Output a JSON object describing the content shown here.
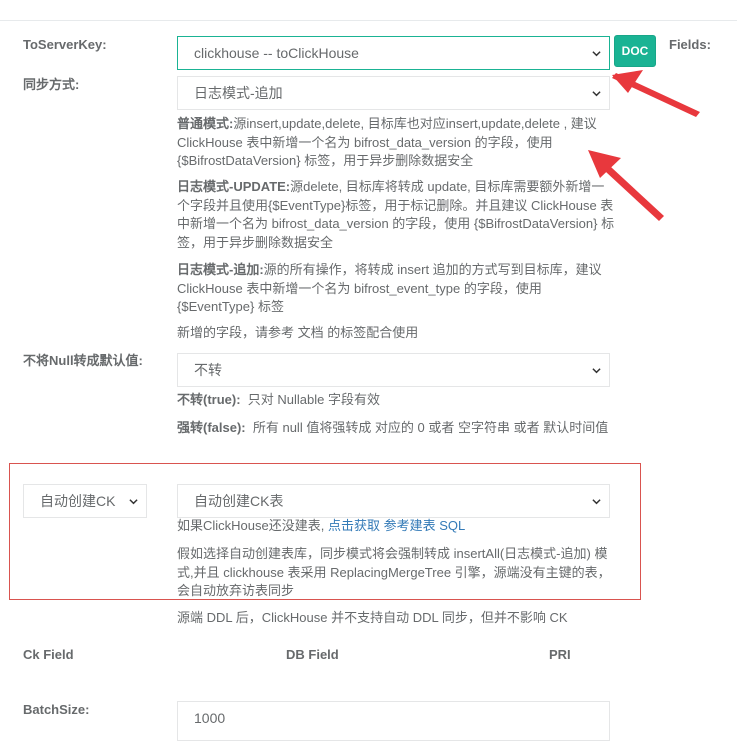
{
  "to_server_key": {
    "label": "ToServerKey:",
    "value": "clickhouse -- toClickHouse",
    "doc_label": "DOC",
    "fields_label": "Fields:"
  },
  "sync_mode": {
    "label": "同步方式:",
    "value": "日志模式-追加",
    "help_normal_title": "普通模式:",
    "help_normal_text": "源insert,update,delete, 目标库也对应insert,update,delete , 建议ClickHouse 表中新增一个名为 bifrost_data_version 的字段，使用 {$BifrostDataVersion} 标签，用于异步删除数据安全",
    "help_update_title": "日志模式-UPDATE:",
    "help_update_text": "源delete, 目标库将转成 update, 目标库需要额外新增一个字段并且使用{$EventType}标签，用于标记删除。并且建议 ClickHouse 表中新增一个名为 bifrost_data_version 的字段，使用 {$BifrostDataVersion} 标签，用于异步删除数据安全",
    "help_append_title": "日志模式-追加:",
    "help_append_text": "源的所有操作，将转成 insert 追加的方式写到目标库，建议 ClickHouse 表中新增一个名为 bifrost_event_type 的字段，使用 {$EventType} 标签",
    "help_footer": "新增的字段，请参考 文档 的标签配合使用"
  },
  "null_convert": {
    "label": "不将Null转成默认值:",
    "value": "不转",
    "help_no_title": "不转(true):",
    "help_no_text": "只对 Nullable 字段有效",
    "help_force_title": "强转(false):",
    "help_force_text": "所有 null 值将强转成 对应的 0 或者 空字符串 或者 默认时间值"
  },
  "auto_create": {
    "left_value": "自动创建CK",
    "value": "自动创建CK表",
    "hint_prefix": "如果ClickHouse还没建表,",
    "hint_link1": "点击获取",
    "hint_link2": "参考建表 SQL",
    "help_text": "假如选择自动创建表库，同步模式将会强制转成 insertAll(日志模式-追加) 模式,并且 clickhouse 表采用 ReplacingMergeTree 引擎，源端没有主键的表，会自动放弃访表同步",
    "ddl_note": "源端 DDL 后，ClickHouse 并不支持自动 DDL 同步，但并不影响 CK"
  },
  "field_table": {
    "col_ck": "Ck Field",
    "col_db": "DB Field",
    "col_pri": "PRI"
  },
  "batch": {
    "label": "BatchSize:",
    "value": "1000"
  },
  "colors": {
    "accent": "#1ab394",
    "annotation_red": "#e8383d",
    "link": "#337ab7"
  },
  "icons": [
    "chevron-down-icon",
    "red-arrow-annotation"
  ]
}
